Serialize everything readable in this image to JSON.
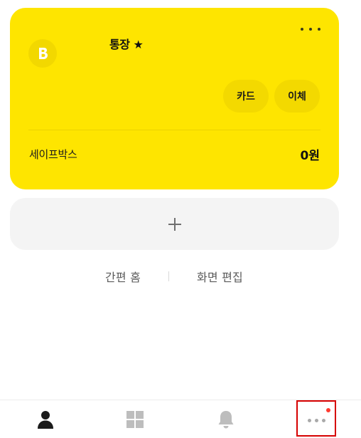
{
  "account_card": {
    "name": "통장 ★",
    "bank_logo_letter": "B",
    "more_icon": "more-horizontal-icon",
    "buttons": {
      "card_label": "카드",
      "transfer_label": "이체"
    },
    "safebox": {
      "label": "세이프박스",
      "amount": "0원"
    }
  },
  "add_account": {
    "icon": "plus-icon"
  },
  "links": {
    "simple_home": "간편 홈",
    "edit_screen": "화면 편집"
  },
  "tabbar": {
    "tabs": [
      {
        "id": "home",
        "icon": "person-icon",
        "active": true
      },
      {
        "id": "menu",
        "icon": "grid-icon",
        "active": false
      },
      {
        "id": "alerts",
        "icon": "bell-icon",
        "active": false
      },
      {
        "id": "more",
        "icon": "more-dots-icon",
        "active": false,
        "has_badge": true
      }
    ]
  },
  "colors": {
    "card_yellow": "#fee500",
    "pill_yellow": "#f3d900",
    "add_bg": "#f4f4f4",
    "badge_red": "#ff3b30",
    "highlight_red": "#d60000"
  }
}
